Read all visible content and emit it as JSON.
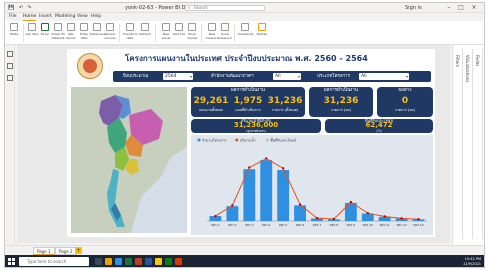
{
  "app": {
    "window_title": "yonk-02-63 - Power BI Desktop",
    "search_placeholder": "Search",
    "user_label": "Sign in"
  },
  "menu": {
    "tabs": [
      "File",
      "Home",
      "Insert",
      "Modeling",
      "View",
      "Help"
    ],
    "active": "Home"
  },
  "ribbon": {
    "buttons": [
      "Paste",
      "Get data",
      "Excel",
      "Power BI datasets",
      "SQL Server",
      "Enter data",
      "Dataverse",
      "Recent sources",
      "Transform data",
      "Refresh",
      "New visual",
      "Text box",
      "More visuals",
      "New measure",
      "Quick measure",
      "Sensitivity",
      "Publish"
    ]
  },
  "report": {
    "title": "โครงการแผนงานในประเทศ ประจำปีงบประมาณ พ.ศ. 2560 - 2564",
    "filters": [
      {
        "label": "ปีงบประมาณ",
        "value": "2564"
      },
      {
        "label": "สำนักงานพัฒนาภาคฯ",
        "value": "All"
      },
      {
        "label": "ประเภทโครงการ",
        "value": "All"
      }
    ],
    "cards": {
      "summary": {
        "title": "ผลการดำเนินงาน",
        "items": [
          {
            "value": "29,261",
            "label": "แผนงานทั้งหมด"
          },
          {
            "value": "1,975",
            "label": "แผนที่ดำเนินการ"
          },
          {
            "value": "31,236",
            "label": "รายการ (ทั้งหมด)"
          }
        ]
      },
      "result": {
        "title": "ผลการดำเนินงาน",
        "value": "31,236",
        "label": "รายการ (ผล)"
      },
      "pending": {
        "title": "ผลต่าง",
        "value": "0",
        "label": "รายการ (ผล)"
      },
      "budget": {
        "title": "ปริมาณน้ำที่เก็บกัก",
        "value": "31,236,000",
        "label": "(ลูกบาศก์เมตร)"
      },
      "area": {
        "title": "พื้นที่รับประโยชน์",
        "value": "62,472",
        "label": "(ไร่)"
      }
    }
  },
  "chart_data": {
    "type": "bar",
    "title": "",
    "legend": [
      "จำนวนโครงการ",
      "ปริมาณน้ำ",
      "พื้นที่รับประโยชน์"
    ],
    "ylabel": "",
    "xlabel": "",
    "categories": [
      "ทดร.1",
      "ทดร.2",
      "ทดร.3",
      "ทดร.4",
      "ทดร.5",
      "ทดร.6",
      "ทดร.7",
      "ทดร.8",
      "ทดร.9",
      "ทดร.10",
      "ทดร.11",
      "ทดร.12",
      "ทดร.13"
    ],
    "series": [
      {
        "name": "จำนวนโครงการ",
        "values": [
          600,
          1800,
          6300,
          7400,
          6200,
          1900,
          300,
          200,
          2200,
          900,
          500,
          300,
          200
        ]
      }
    ],
    "line_values": [
      600,
      1900,
      6500,
      7600,
      6400,
      2000,
      350,
      250,
      2300,
      950,
      550,
      320,
      220
    ],
    "ylim": [
      0,
      9000
    ],
    "colors": {
      "bar": "#2f8fe0",
      "line": "#e8501a",
      "marker": "#c00000"
    }
  },
  "pages": [
    "Page 1",
    "Page 2"
  ],
  "taskbar": {
    "search_placeholder": "Type here to search",
    "time": "10:42 PM",
    "date": "12/9/2021"
  },
  "rightpane": {
    "labels": [
      "Filters",
      "Visualizations",
      "Fields"
    ]
  }
}
